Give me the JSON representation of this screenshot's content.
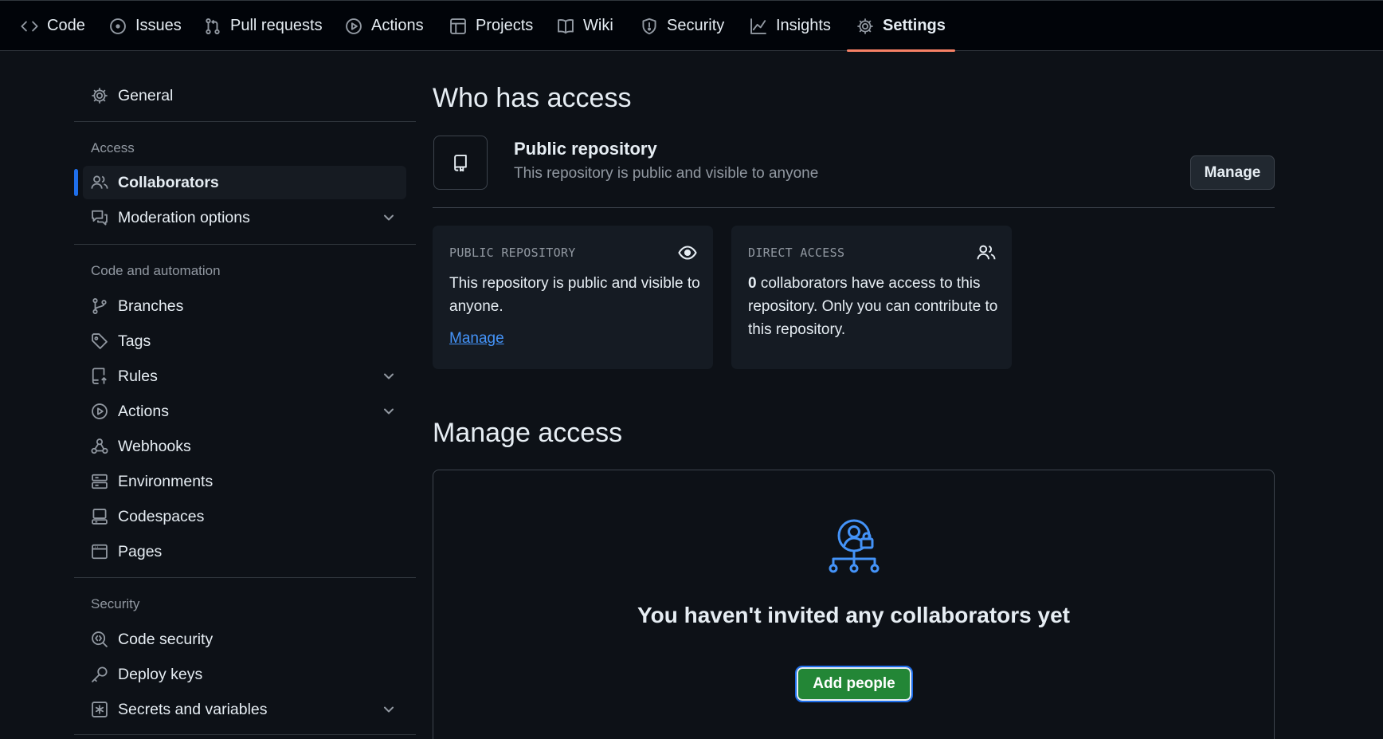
{
  "nav": {
    "tabs": [
      {
        "label": "Code",
        "icon": "code-icon"
      },
      {
        "label": "Issues",
        "icon": "issue-icon"
      },
      {
        "label": "Pull requests",
        "icon": "pull-request-icon"
      },
      {
        "label": "Actions",
        "icon": "play-icon"
      },
      {
        "label": "Projects",
        "icon": "table-icon"
      },
      {
        "label": "Wiki",
        "icon": "book-icon"
      },
      {
        "label": "Security",
        "icon": "shield-icon"
      },
      {
        "label": "Insights",
        "icon": "graph-icon"
      },
      {
        "label": "Settings",
        "icon": "gear-icon",
        "active": true
      }
    ]
  },
  "sidebar": {
    "general": "General",
    "access_heading": "Access",
    "collaborators": "Collaborators",
    "moderation": "Moderation options",
    "code_heading": "Code and automation",
    "branches": "Branches",
    "tags": "Tags",
    "rules": "Rules",
    "actions": "Actions",
    "webhooks": "Webhooks",
    "environments": "Environments",
    "codespaces": "Codespaces",
    "pages": "Pages",
    "security_heading": "Security",
    "code_security": "Code security",
    "deploy_keys": "Deploy keys",
    "secrets": "Secrets and variables"
  },
  "who": {
    "title": "Who has access",
    "repo_title": "Public repository",
    "repo_desc": "This repository is public and visible to anyone",
    "manage_button": "Manage"
  },
  "cards": {
    "public": {
      "label": "PUBLIC REPOSITORY",
      "text": "This repository is public and visible to anyone.",
      "link": "Manage"
    },
    "direct": {
      "label": "DIRECT ACCESS",
      "count": "0",
      "text": " collaborators have access to this repository. Only you can contribute to this repository."
    }
  },
  "manage": {
    "title": "Manage access",
    "empty_title": "You haven't invited any collaborators yet",
    "add_button": "Add people"
  },
  "colors": {
    "accent": "#1f6feb",
    "tab_underline": "#f78166",
    "primary_button": "#238636",
    "illustration": "#4493f8"
  }
}
